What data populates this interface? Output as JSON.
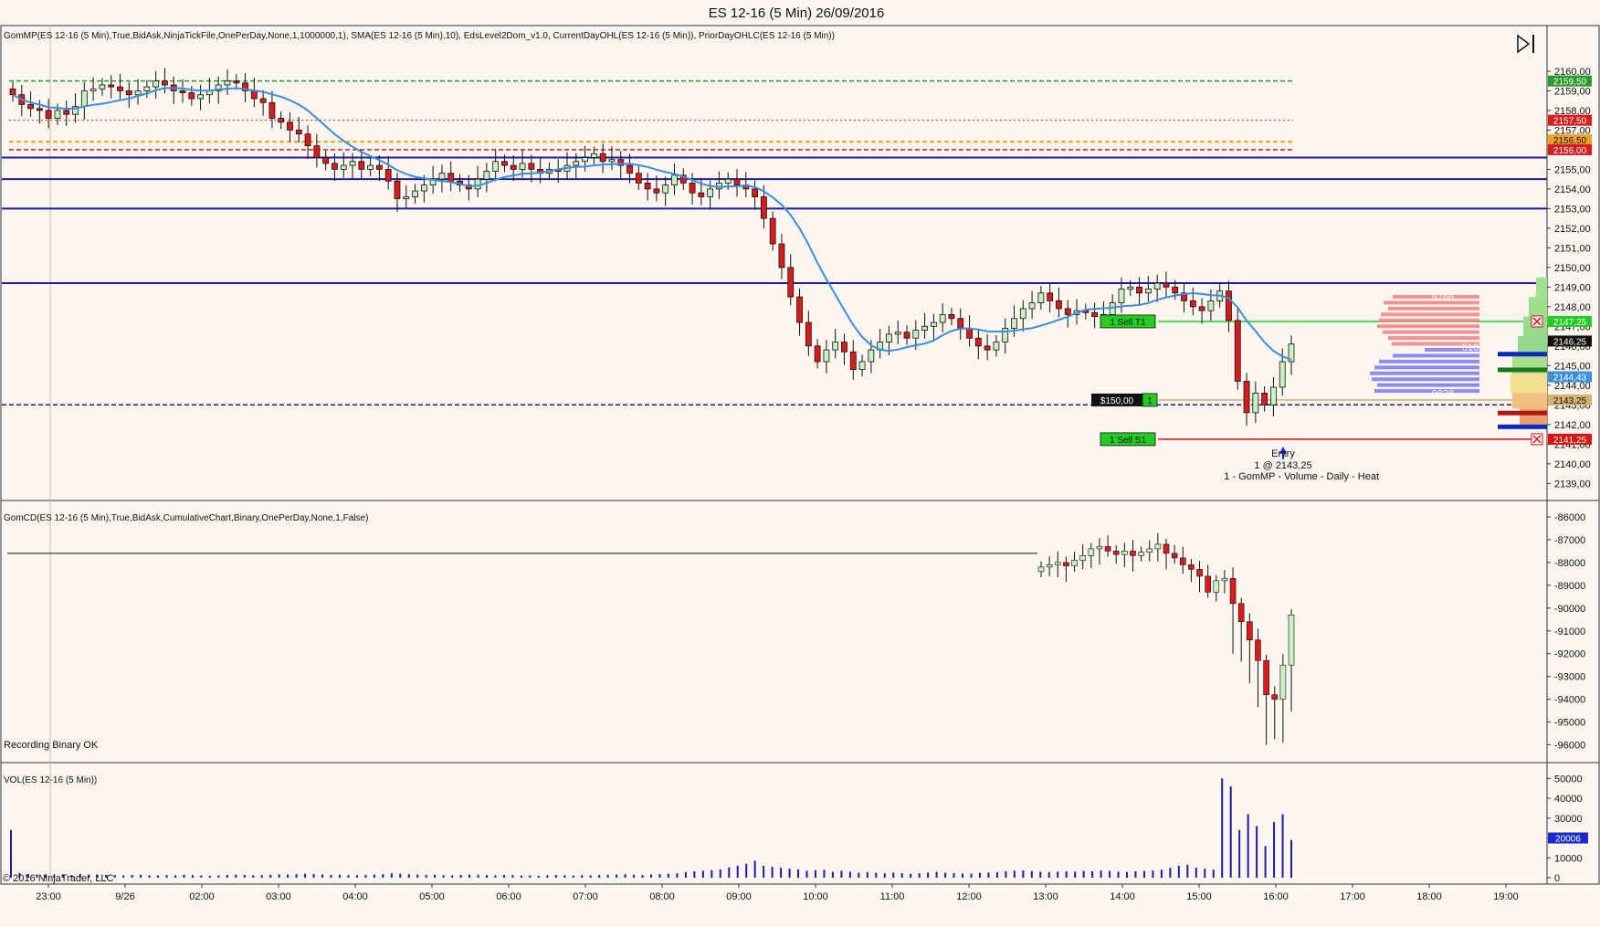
{
  "title": "ES 12-16 (5 Min)  26/09/2016",
  "copyright": "© 2016 NinjaTrader, LLC",
  "colors": {
    "background": "#fdf5ef",
    "up_candle": "#c8f0c0",
    "down_candle": "#d81c1c",
    "sma": "#3a8edc",
    "level_line": "#1c1ca8",
    "target_green": "#22cc22",
    "stop_red": "#dd1111",
    "prior_high": "#2a9a2a",
    "orange_line": "#f0a020",
    "volume_bar": "#1c1ca8"
  },
  "panels": {
    "price": {
      "indicator_label": "GomMP(ES 12-16 (5 Min),True,BidAsk,NinjaTickFile,OnePerDay,None,1,1000000,1), SMA(ES 12-16 (5 Min),10), EdsLevel2Dom_v1.0, CurrentDayOHL(ES 12-16 (5 Min)), PriorDayOHLC(ES 12-16 (5 Min))",
      "footer_label": "1 - GomMP - Volume - Daily - Heat",
      "order_target": "1   Sell T1",
      "order_stop": "1   Sell S1",
      "pnl_label": "$150,00",
      "pnl_qty": "1",
      "entry_label": "Entry",
      "entry_detail": "1 @ 2143,25",
      "profile_labels": [
        "9766",
        "516",
        "9828"
      ]
    },
    "cd": {
      "indicator_label": "GomCD(ES 12-16 (5 Min),True,BidAsk,CumulativeChart,Binary,OnePerDay,None,1,False)",
      "status": "Recording Binary OK"
    },
    "vol": {
      "indicator_label": "VOL(ES 12-16 (5 Min))"
    }
  },
  "chart_data": [
    {
      "type": "candlestick",
      "panel": "price",
      "y_ticks": [
        "2160,00",
        "2159,00",
        "2158,00",
        "2157,00",
        "2156,00",
        "2155,00",
        "2154,00",
        "2153,00",
        "2152,00",
        "2151,00",
        "2150,00",
        "2149,00",
        "2148,00",
        "2147,00",
        "2146,00",
        "2145,00",
        "2144,00",
        "2143,00",
        "2142,00",
        "2141,00",
        "2140,00",
        "2139,00"
      ],
      "ylim": [
        2138.5,
        2161.3
      ],
      "x_ticks": [
        "23:00",
        "9/26",
        "02:00",
        "03:00",
        "04:00",
        "05:00",
        "06:00",
        "07:00",
        "08:00",
        "09:00",
        "10:00",
        "11:00",
        "12:00",
        "13:00",
        "14:00",
        "15:00",
        "16:00",
        "17:00",
        "18:00",
        "19:00"
      ],
      "price_tags": [
        {
          "value": 2159.5,
          "label": "2159,50",
          "color": "#2a9a2a"
        },
        {
          "value": 2157.5,
          "label": "2157,50",
          "color": "#d81c1c"
        },
        {
          "value": 2156.5,
          "label": "2156,50",
          "color": "#f0a020"
        },
        {
          "value": 2156.0,
          "label": "2156,00",
          "color": "#d81c1c"
        },
        {
          "value": 2147.25,
          "label": "2147,25",
          "color": "#22cc22"
        },
        {
          "value": 2146.25,
          "label": "2146,25",
          "color": "#111111"
        },
        {
          "value": 2144.43,
          "label": "2144,43",
          "color": "#3a8edc"
        },
        {
          "value": 2143.25,
          "label": "2143,25",
          "color": "#d8b070"
        },
        {
          "value": 2141.25,
          "label": "2141,25",
          "color": "#dd1111"
        }
      ],
      "levels": [
        2155.6,
        2154.5,
        2153.0,
        2149.2
      ],
      "dashed_level": 2143.0,
      "prior_high": 2159.5,
      "prior_close": 2157.5,
      "orange_level": 2156.4,
      "prior_low": 2156.0,
      "target": 2147.25,
      "stop": 2141.25,
      "entry": 2143.25,
      "series": [
        {
          "name": "OHLC",
          "closes": [
            2158.8,
            2158.3,
            2158.1,
            2158.0,
            2157.6,
            2158.0,
            2157.8,
            2158.2,
            2159.0,
            2159.1,
            2159.3,
            2159.2,
            2159.0,
            2158.8,
            2159.0,
            2159.2,
            2159.5,
            2159.3,
            2159.0,
            2158.9,
            2158.6,
            2158.8,
            2159.0,
            2159.3,
            2159.5,
            2159.4,
            2159.0,
            2158.6,
            2158.4,
            2157.6,
            2157.4,
            2157.0,
            2156.8,
            2156.2,
            2155.6,
            2155.3,
            2155.0,
            2155.2,
            2155.4,
            2155.0,
            2155.2,
            2155.0,
            2154.4,
            2153.5,
            2153.6,
            2153.9,
            2154.2,
            2154.5,
            2154.8,
            2154.4,
            2154.2,
            2154.0,
            2154.5,
            2154.9,
            2155.4,
            2155.2,
            2155.0,
            2155.3,
            2155.0,
            2154.8,
            2155.0,
            2154.9,
            2155.2,
            2155.4,
            2155.6,
            2155.8,
            2155.4,
            2155.5,
            2155.2,
            2154.8,
            2154.3,
            2154.0,
            2153.8,
            2154.2,
            2154.7,
            2154.3,
            2153.8,
            2153.6,
            2154.0,
            2154.3,
            2154.5,
            2154.2,
            2154.0,
            2153.6,
            2152.5,
            2151.2,
            2150.0,
            2148.5,
            2147.2,
            2146.0,
            2145.2,
            2145.8,
            2146.2,
            2145.7,
            2144.8,
            2145.2,
            2145.8,
            2146.2,
            2146.6,
            2146.7,
            2146.4,
            2146.8,
            2147.0,
            2147.2,
            2147.6,
            2147.4,
            2146.9,
            2146.4,
            2146.0,
            2145.8,
            2146.2,
            2146.9,
            2147.4,
            2147.9,
            2148.2,
            2148.7,
            2148.3,
            2147.9,
            2147.6,
            2147.8,
            2147.7,
            2147.5,
            2147.6,
            2148.2,
            2148.9,
            2149.0,
            2148.7,
            2148.9,
            2149.2,
            2149.0,
            2148.7,
            2148.3,
            2148.0,
            2147.8,
            2148.3,
            2148.8,
            2147.3,
            2144.2,
            2142.6,
            2143.6,
            2143.0,
            2143.9,
            2145.2,
            2146.1
          ],
          "ohlc_note": "approximate closes read from the chart"
        }
      ]
    },
    {
      "type": "candlestick",
      "panel": "cd",
      "y_ticks": [
        "-86000",
        "-87000",
        "-88000",
        "-89000",
        "-90000",
        "-91000",
        "-92000",
        "-93000",
        "-94000",
        "-95000",
        "-96000"
      ],
      "ylim": [
        -96500,
        -85600
      ],
      "baseline": -87600,
      "series": [
        {
          "name": "Cumulative delta",
          "closes": [
            -88200,
            -88100,
            -88000,
            -88150,
            -87900,
            -87700,
            -87400,
            -87300,
            -87500,
            -87650,
            -87500,
            -87700,
            -87550,
            -87400,
            -87200,
            -87600,
            -87800,
            -88100,
            -88300,
            -88600,
            -89300,
            -88800,
            -88700,
            -89800,
            -90600,
            -91400,
            -92300,
            -93800,
            -94000,
            -92500,
            -90300
          ]
        }
      ]
    },
    {
      "type": "bar",
      "panel": "vol",
      "y_ticks": [
        "50000",
        "40000",
        "30000",
        "20000",
        "10000",
        "0"
      ],
      "ylim": [
        0,
        52000
      ],
      "tag": {
        "value": 20006,
        "label": "20006"
      },
      "series": [
        {
          "name": "Volume",
          "values": [
            24000,
            2400,
            1800,
            1600,
            1500,
            1400,
            1200,
            1400,
            1800,
            1600,
            1500,
            1400,
            1300,
            1200,
            1400,
            1500,
            1200,
            1100,
            1300,
            1200,
            1500,
            1300,
            1100,
            1000,
            1200,
            1400,
            1600,
            1400,
            1200,
            1300,
            1500,
            1700,
            1600,
            1800,
            2000,
            1800,
            1600,
            1400,
            1500,
            1300,
            1200,
            1400,
            1600,
            1800,
            2200,
            2000,
            1800,
            1600,
            1400,
            1500,
            1300,
            1200,
            1400,
            1600,
            1500,
            1300,
            1200,
            1400,
            1300,
            1100,
            1200,
            1000,
            1300,
            1400,
            1200,
            1100,
            1300,
            1200,
            1400,
            1500,
            1600,
            1800,
            1500,
            1300,
            1600,
            1800,
            2000,
            2200,
            2800,
            3200,
            3500,
            3800,
            4200,
            5200,
            6000,
            7000,
            8500,
            6000,
            5500,
            5000,
            4500,
            4200,
            3500,
            3800,
            4000,
            3000,
            3500,
            3000,
            2500,
            2800,
            2500,
            2200,
            2600,
            2300,
            2000,
            2200,
            2600,
            2900,
            2500,
            2300,
            2100,
            2000,
            2400,
            2600,
            2800,
            3200,
            3500,
            3700,
            3300,
            3000,
            2800,
            3000,
            3200,
            3000,
            3400,
            3200,
            3600,
            3400,
            3000,
            2800,
            3200,
            3400,
            3600,
            4000,
            5000,
            6000,
            6500,
            5000,
            4500,
            4000,
            50000,
            46000,
            24000,
            32000,
            26000,
            16000,
            28000,
            32000,
            19000
          ]
        }
      ]
    }
  ]
}
